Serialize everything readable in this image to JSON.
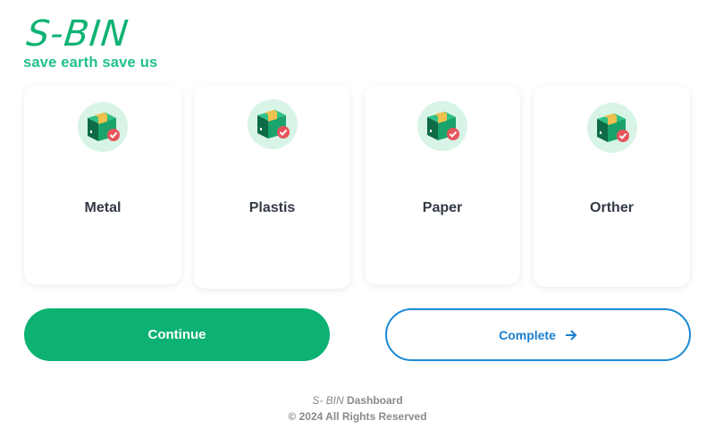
{
  "brand": {
    "logo": "S-BIN",
    "tagline": "save earth save us"
  },
  "categories": [
    {
      "label": "Metal",
      "icon": "box-check-icon"
    },
    {
      "label": "Plastis",
      "icon": "box-check-icon"
    },
    {
      "label": "Paper",
      "icon": "box-check-icon"
    },
    {
      "label": "Orther",
      "icon": "box-check-icon"
    }
  ],
  "actions": {
    "continue_label": "Continue",
    "complete_label": "Complete",
    "complete_icon": "arrow-right-icon"
  },
  "footer": {
    "brand": "S- BIN",
    "title": "Dashboard",
    "copyright": "© 2024 All Rights Reserved"
  },
  "colors": {
    "primary_green": "#0db272",
    "accent_blue": "#1a8ad6",
    "icon_bg": "#d8f4e7"
  }
}
